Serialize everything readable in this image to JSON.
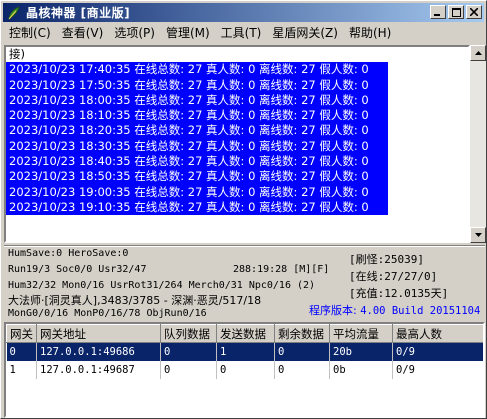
{
  "window": {
    "title": "晶核神器 [商业版]"
  },
  "menu": [
    "控制(C)",
    "查看(V)",
    "选项(P)",
    "管理(M)",
    "工具(T)",
    "星盾网关(Z)",
    "帮助(H)"
  ],
  "log": {
    "first_line": "接)",
    "lines": [
      "2023/10/23 17:40:35 在线总数: 27 真人数: 0 离线数: 27 假人数: 0",
      "2023/10/23 17:50:35 在线总数: 27 真人数: 0 离线数: 27 假人数: 0",
      "2023/10/23 18:00:35 在线总数: 27 真人数: 0 离线数: 27 假人数: 0",
      "2023/10/23 18:10:35 在线总数: 27 真人数: 0 离线数: 27 假人数: 0",
      "2023/10/23 18:20:35 在线总数: 27 真人数: 0 离线数: 27 假人数: 0",
      "2023/10/23 18:30:35 在线总数: 27 真人数: 0 离线数: 27 假人数: 0",
      "2023/10/23 18:40:35 在线总数: 27 真人数: 0 离线数: 27 假人数: 0",
      "2023/10/23 18:50:35 在线总数: 27 真人数: 0 离线数: 27 假人数: 0",
      "2023/10/23 19:00:35 在线总数: 27 真人数: 0 离线数: 27 假人数: 0",
      "2023/10/23 19:10:35 在线总数: 27 真人数: 0 离线数: 27 假人数: 0"
    ]
  },
  "stats": {
    "save": "HumSave:0 HeroSave:0",
    "run": "Run19/3 Soc0/0 Usr32/47",
    "uptime": "288:19:28 [M][F]",
    "hum": "Hum32/32 Mon0/16 UsrRot31/264 Merch0/31 Npc0/16 (2)",
    "player": "大法师·[洞灵真人],3483/3785 - 深渊·恶灵/517/18",
    "mon": "MonG0/0/16 MonP0/16/78 ObjRun0/16",
    "refresh": "[刷怪:25039]",
    "online": "[在线:27/27/0]",
    "recharge": "[充值:12.0135天]",
    "version_label": "程序版本:",
    "version_value": "4.00 Build 20151104"
  },
  "table": {
    "headers": [
      "网关",
      "网关地址",
      "队列数据",
      "发送数据",
      "剩余数据",
      "平均流量",
      "最高人数"
    ],
    "rows": [
      [
        "0",
        "127.0.0.1:49686",
        "0",
        "1",
        "0",
        "20b",
        "0/9"
      ],
      [
        "1",
        "127.0.0.1:49687",
        "0",
        "0",
        "0",
        "0b",
        "0/9"
      ]
    ]
  }
}
